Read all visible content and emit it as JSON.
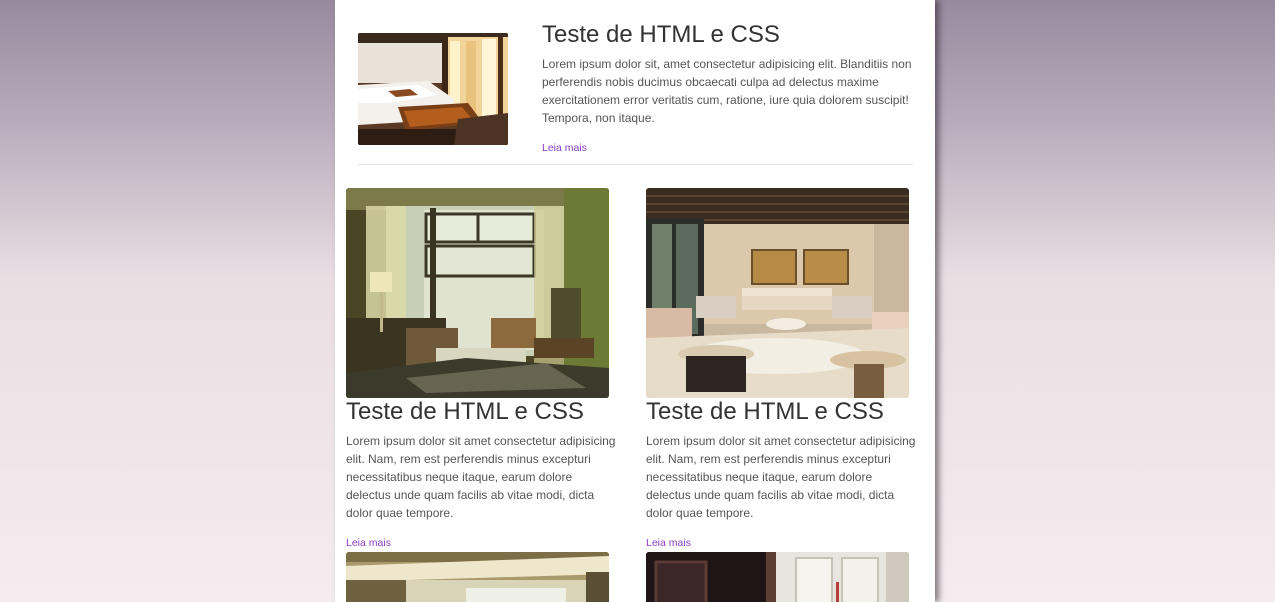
{
  "featured": {
    "image_alt": "hotel-bedroom-photo",
    "title": "Teste de HTML e CSS",
    "text": "Lorem ipsum dolor sit, amet consectetur adipisicing elit. Blanditiis non perferendis nobis ducimus obcaecati culpa ad delectus maxime exercitationem error veritatis cum, ratione, iure quia dolorem suscipit! Tempora, non itaque.",
    "link": "Leia mais"
  },
  "cards": [
    {
      "image_alt": "hotel-room-window-photo",
      "title": "Teste de HTML e CSS",
      "text": "Lorem ipsum dolor sit amet consectetur adipisicing elit. Nam, rem est perferendis minus excepturi necessitatibus neque itaque, earum dolore delectus unde quam facilis ab vitae modi, dicta dolor quae tempore.",
      "link": "Leia mais"
    },
    {
      "image_alt": "hotel-lounge-photo",
      "title": "Teste de HTML e CSS",
      "text": "Lorem ipsum dolor sit amet consectetur adipisicing elit. Nam, rem est perferendis minus excepturi necessitatibus neque itaque, earum dolore delectus unde quam facilis ab vitae modi, dicta dolor quae tempore.",
      "link": "Leia mais"
    }
  ],
  "colors": {
    "link": "#8a3ec9",
    "title": "#333333",
    "body_text": "#555555"
  }
}
